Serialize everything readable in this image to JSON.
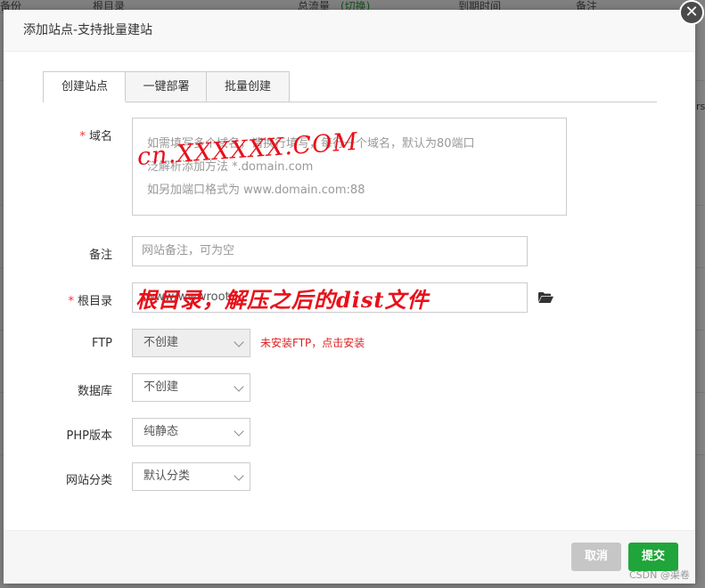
{
  "background": {
    "headers": [
      "备份",
      "根目录",
      "总流量",
      "(切换)",
      "到期时间",
      "备注"
    ],
    "right_stub": "rst"
  },
  "dialog": {
    "title": "添加站点-支持批量建站",
    "close_glyph": "✕",
    "tabs": [
      {
        "label": "创建站点",
        "active": true
      },
      {
        "label": "一键部署",
        "active": false
      },
      {
        "label": "批量创建",
        "active": false
      }
    ],
    "required_mark": "*",
    "domain": {
      "label": "域名",
      "placeholder_lines": [
        "如需填写多个域名，请换行填写，每行一个域名，默认为80端口",
        "泛解析添加方法 *.domain.com",
        "如另加端口格式为 www.domain.com:88"
      ],
      "annotation": "cn.XXXXXX.COM"
    },
    "remark": {
      "label": "备注",
      "placeholder": "网站备注，可为空"
    },
    "root_dir": {
      "label": "根目录",
      "value": "/www/wwwroot",
      "annotation": "根目录，解压之后的dist文件",
      "icon": "folder-open-icon"
    },
    "ftp": {
      "label": "FTP",
      "value": "不创建",
      "warning": "未安装FTP，点击安装"
    },
    "database": {
      "label": "数据库",
      "value": "不创建"
    },
    "php": {
      "label": "PHP版本",
      "value": "纯静态"
    },
    "category": {
      "label": "网站分类",
      "value": "默认分类"
    },
    "buttons": {
      "cancel": "取消",
      "submit": "提交"
    }
  },
  "watermark": "CSDN @渠卷",
  "colors": {
    "accent": "#20a53a",
    "warning": "#e02020",
    "annotation": "#e8101a",
    "cancel": "#c6c6c6"
  }
}
